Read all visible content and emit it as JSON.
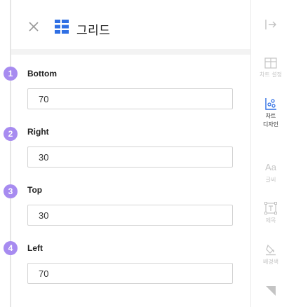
{
  "header": {
    "title": "그리드"
  },
  "fields": [
    {
      "step": "1",
      "label": "Bottom",
      "value": "70"
    },
    {
      "step": "2",
      "label": "Right",
      "value": "30"
    },
    {
      "step": "3",
      "label": "Top",
      "value": "30"
    },
    {
      "step": "4",
      "label": "Left",
      "value": "70"
    }
  ],
  "sidebar": {
    "items": [
      {
        "icon": "table-icon",
        "label": "차트 설정"
      },
      {
        "icon": "chart-design-icon",
        "label": "차트\n디자인"
      },
      {
        "icon": "font-icon",
        "label": "글씨"
      },
      {
        "icon": "title-icon",
        "label": "제목"
      },
      {
        "icon": "fill-bucket-icon",
        "label": "배경색"
      }
    ]
  },
  "colors": {
    "accent": "#a78bf0",
    "brand_blue": "#2f6fe4"
  }
}
